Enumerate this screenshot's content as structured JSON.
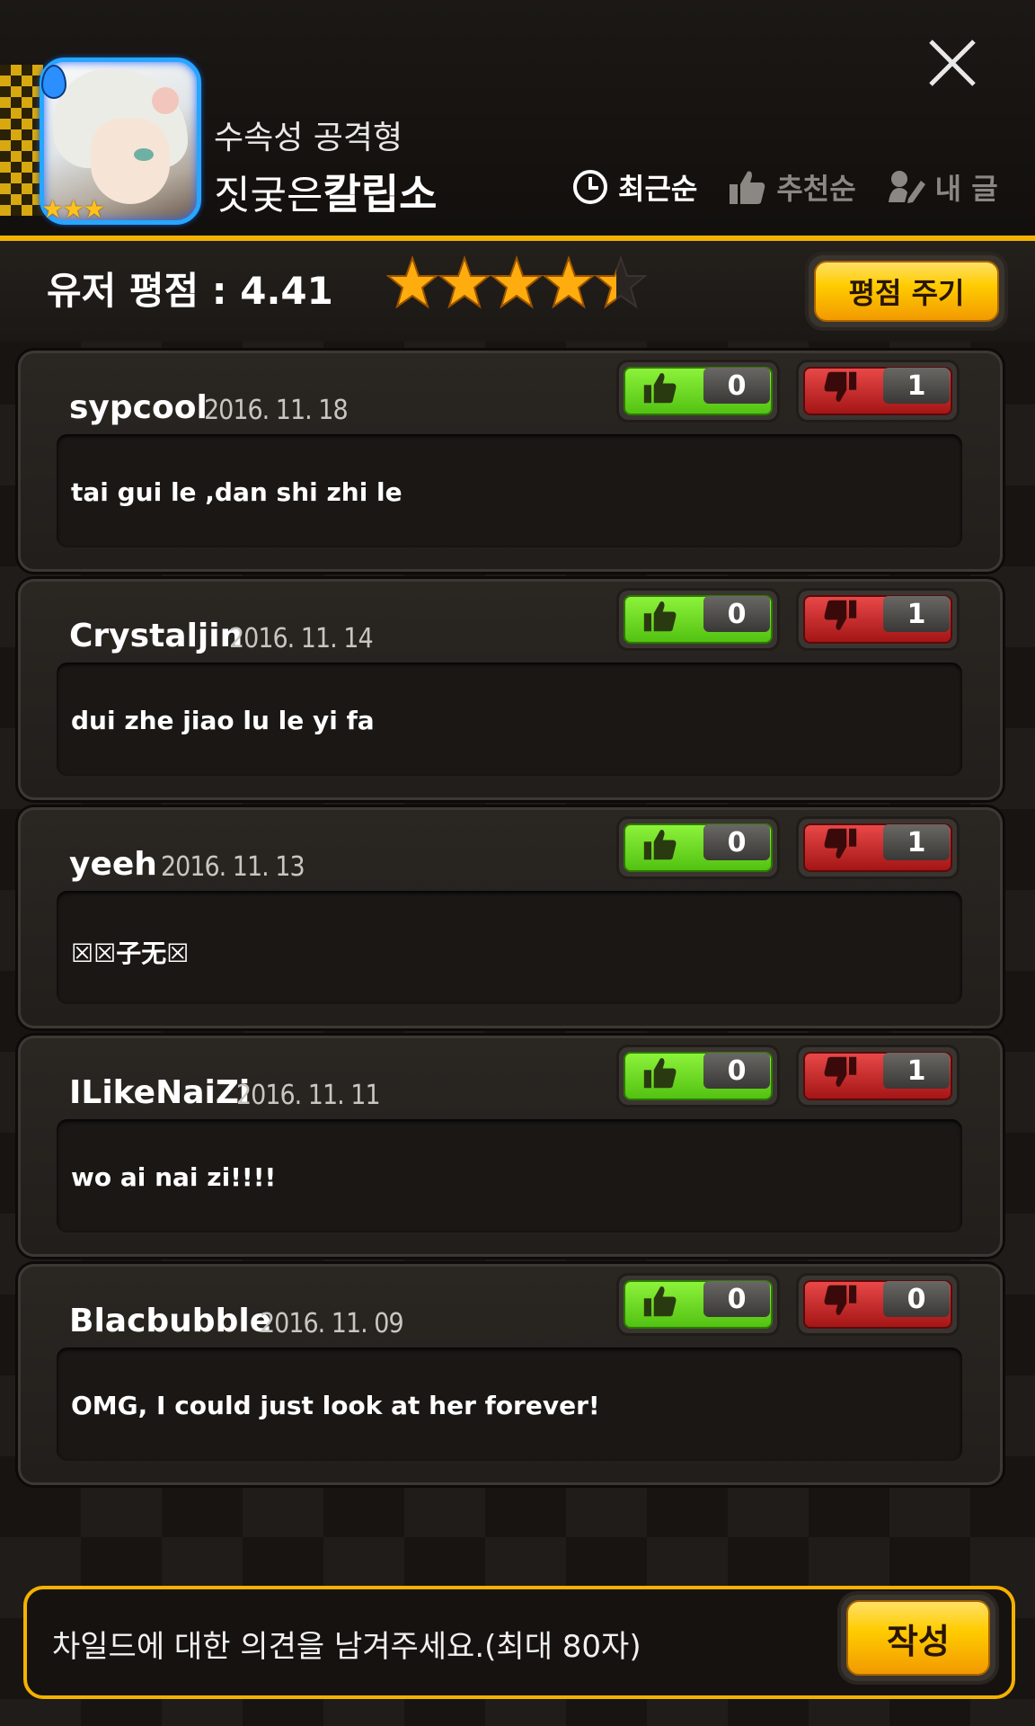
{
  "hero": {
    "element_icon": "water-drop-icon",
    "star_count": 3,
    "stars": "★★★",
    "type": "수속성 공격형",
    "name_prefix": "짓궂은",
    "name": "칼립소"
  },
  "close_icon": "close-icon",
  "sort_tabs": [
    {
      "label": "최근순",
      "icon": "clock-icon",
      "active": true
    },
    {
      "label": "추천순",
      "icon": "thumbs-up-icon",
      "active": false
    },
    {
      "label": "내 글",
      "icon": "write-icon",
      "active": false
    }
  ],
  "rating": {
    "label": "유저 평점 : 4.41",
    "value": 4.41,
    "max": 5,
    "button_label": "평점 주기"
  },
  "reviews": [
    {
      "user": "sypcool",
      "date": "2016. 11. 18",
      "text": "tai  gui  le ,dan  shi  zhi le",
      "up": "0",
      "down": "1"
    },
    {
      "user": "Crystaljin",
      "date": "2016. 11. 14",
      "text": "dui zhe jiao lu le yi fa",
      "up": "0",
      "down": "1"
    },
    {
      "user": "yeeh",
      "date": "2016. 11. 13",
      "text": "☒☒子无☒",
      "up": "0",
      "down": "1"
    },
    {
      "user": "ILikeNaiZi",
      "date": "2016. 11. 11",
      "text": "wo ai nai zi!!!!",
      "up": "0",
      "down": "1"
    },
    {
      "user": "Blacbubble",
      "date": "2016. 11. 09",
      "text": "OMG, I could just look at her forever!",
      "up": "0",
      "down": "0"
    }
  ],
  "compose": {
    "placeholder": "차일드에 대한 의견을 남겨주세요.(최대 80자)",
    "button_label": "작성"
  },
  "colors": {
    "accent_gold": "#f5b100",
    "upvote_green": "#6bd824",
    "downvote_red": "#c62424",
    "frame_blue": "#27a6ff"
  }
}
